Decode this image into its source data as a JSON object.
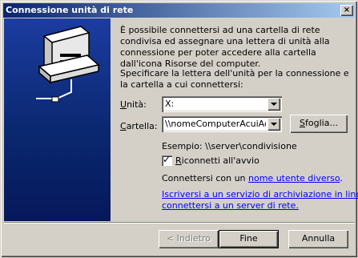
{
  "window": {
    "title": "Connessione unità di rete",
    "close_glyph": "×"
  },
  "intro_text": "È possibile connettersi ad una cartella di rete condivisa ed assegnare una lettera di unità alla connessione per poter accedere alla cartella dall'icona Risorse del computer.",
  "instruction_text": "Specificare la lettera dell'unità per la connessione e la cartella a cui connettersi:",
  "drive": {
    "label_u": "U",
    "label_rest": "nità:",
    "value": "X:"
  },
  "folder": {
    "label_u": "C",
    "label_rest": "artella:",
    "value": "\\\\nomeComputerAcuiAcce"
  },
  "browse_button": {
    "label_u": "S",
    "label_rest": "foglia..."
  },
  "example_text": "Esempio: \\\\server\\condivisione",
  "reconnect": {
    "label_u": "R",
    "label_rest": "iconnetti all'avvio",
    "checked": true,
    "check_glyph": "✓"
  },
  "connect_as": {
    "prefix": "Connettersi con un ",
    "link": "nome utente diverso",
    "suffix": "."
  },
  "archive_link": {
    "line1": "Iscriversi a un servizio di archiviazione in linea o",
    "line2": "connettersi a un server di rete."
  },
  "buttons": {
    "back": "< Indietro",
    "finish": "Fine",
    "cancel": "Annulla"
  },
  "colors": {
    "side_panel_top": "#1c3ca0",
    "side_panel_bottom": "#06185a",
    "title_bar_start": "#0a246a",
    "title_bar_end": "#a6caf0",
    "link": "#0000ff"
  },
  "icons": {
    "side_panel": "network-drive-icon"
  }
}
